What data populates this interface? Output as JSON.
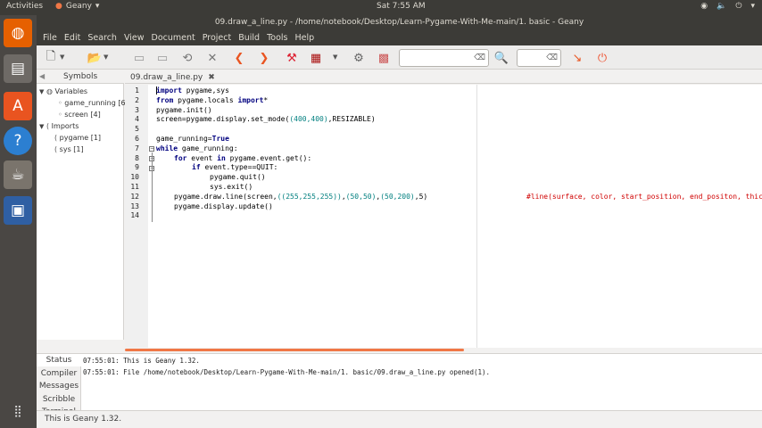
{
  "topbar": {
    "activities": "Activities",
    "app_name": "Geany",
    "clock": "Sat  7:55 AM"
  },
  "window": {
    "title": "09.draw_a_line.py - /home/notebook/Desktop/Learn-Pygame-With-Me-main/1. basic - Geany"
  },
  "menu": [
    "File",
    "Edit",
    "Search",
    "View",
    "Document",
    "Project",
    "Build",
    "Tools",
    "Help"
  ],
  "toolbar": {
    "search_value": "",
    "goto_value": ""
  },
  "sidebar": {
    "tab_label": "Symbols",
    "variables_label": "Variables",
    "variables": [
      "game_running [6",
      "screen [4]"
    ],
    "imports_label": "Imports",
    "imports": [
      "pygame [1]",
      "sys [1]"
    ]
  },
  "editor": {
    "tab_label": "09.draw_a_line.py",
    "line_numbers": [
      "1",
      "2",
      "3",
      "4",
      "5",
      "6",
      "7",
      "8",
      "9",
      "10",
      "11",
      "12",
      "13",
      "14"
    ],
    "lines": {
      "l1_kw": "import",
      "l1_rest": " pygame,sys",
      "l2_kw1": "from",
      "l2_mid": " pygame.locals ",
      "l2_kw2": "import",
      "l2_rest": "*",
      "l3": "pygame.init()",
      "l4_a": "screen=pygame.display.set_mode(",
      "l4_b": "(400,400)",
      "l4_c": ",RESIZABLE)",
      "l6_a": "game_running=",
      "l6_kw": "True",
      "l7_kw": "while",
      "l7_rest": " game_running:",
      "l8_kw": "for",
      "l8_mid": " event ",
      "l8_kw2": "in",
      "l8_rest": " pygame.event.get():",
      "l9_kw": "if",
      "l9_rest": " event.type==QUIT:",
      "l10": "pygame.quit()",
      "l11": "sys.exit()",
      "l12_a": "pygame.draw.line(screen,",
      "l12_b": "((255,255,255))",
      "l12_c": ",",
      "l12_d": "(50,50)",
      "l12_e": ",",
      "l12_f": "(50,200)",
      "l12_g": ",5)",
      "l12_comment": "#line(surface, color, start_position, end_positon, thicknes",
      "l13": "pygame.display.update()"
    }
  },
  "messages": {
    "tabs": [
      "Status",
      "Compiler",
      "Messages",
      "Scribble",
      "Terminal"
    ],
    "lines": [
      "07:55:01: This is Geany 1.32.",
      "07:55:01: File /home/notebook/Desktop/Learn-Pygame-With-Me-main/1. basic/09.draw_a_line.py opened(1)."
    ]
  },
  "statusbar": {
    "text": "This is Geany 1.32."
  },
  "colors": {
    "panel": "#3c3b37",
    "launcher": "#4a4744",
    "accent": "#f07746",
    "keyword": "#00007f",
    "number_tuple": "#007f7f",
    "comment": "#d00000"
  }
}
